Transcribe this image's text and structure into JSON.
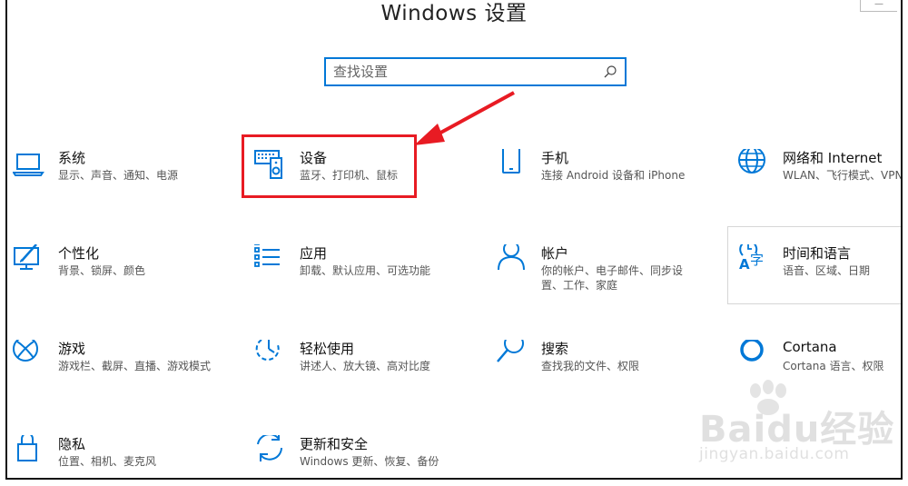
{
  "window": {
    "title": "Windows 设置"
  },
  "search": {
    "placeholder": "查找设置"
  },
  "tiles": [
    {
      "name": "系统",
      "desc": "显示、声音、通知、电源",
      "icon": "laptop-icon"
    },
    {
      "name": "设备",
      "desc": "蓝牙、打印机、鼠标",
      "icon": "devices-icon"
    },
    {
      "name": "手机",
      "desc": "连接 Android 设备和 iPhone",
      "icon": "phone-icon"
    },
    {
      "name": "网络和 Internet",
      "desc": "WLAN、飞行模式、VPN",
      "icon": "globe-icon"
    },
    {
      "name": "个性化",
      "desc": "背景、锁屏、颜色",
      "icon": "personalization-icon"
    },
    {
      "name": "应用",
      "desc": "卸载、默认应用、可选功能",
      "icon": "apps-list-icon"
    },
    {
      "name": "帐户",
      "desc": "你的帐户、电子邮件、同步设置、工作、家庭",
      "icon": "person-icon"
    },
    {
      "name": "时间和语言",
      "desc": "语音、区域、日期",
      "icon": "time-language-icon"
    },
    {
      "name": "游戏",
      "desc": "游戏栏、截屏、直播、游戏模式",
      "icon": "xbox-icon"
    },
    {
      "name": "轻松使用",
      "desc": "讲述人、放大镜、高对比度",
      "icon": "ease-of-access-icon"
    },
    {
      "name": "搜索",
      "desc": "查找我的文件、权限",
      "icon": "search-icon"
    },
    {
      "name": "Cortana",
      "desc": "Cortana 语言、权限",
      "icon": "cortana-icon"
    },
    {
      "name": "隐私",
      "desc": "位置、相机、麦克风",
      "icon": "lock-icon"
    },
    {
      "name": "更新和安全",
      "desc": "Windows 更新、恢复、备份",
      "icon": "update-icon"
    }
  ],
  "watermark": {
    "main": "Baidu经验",
    "sub": "jingyan.baidu.com"
  },
  "colors": {
    "accent": "#0078d7",
    "highlight": "#e81b23"
  }
}
